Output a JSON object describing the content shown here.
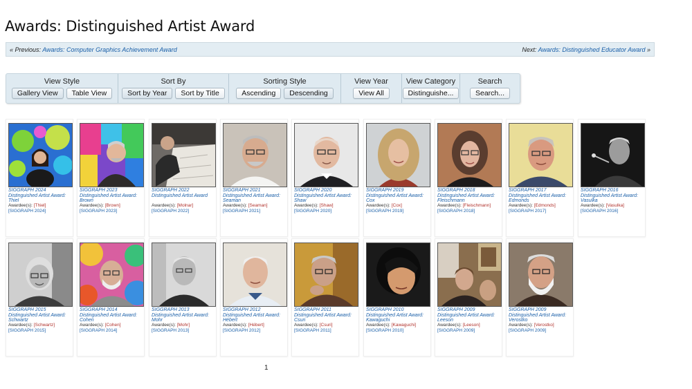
{
  "page": {
    "title": "Awards: Distinguished Artist Award"
  },
  "nav": {
    "prev_prefix": "« Previous: ",
    "prev_link": "Awards: Computer Graphics Achievement Award",
    "next_prefix": "Next: ",
    "next_link": "Awards: Distinguished Educator Award",
    "next_suffix": " »"
  },
  "controls": {
    "view_style": {
      "label": "View Style",
      "buttons": [
        "Gallery View",
        "Table View"
      ]
    },
    "sort_by": {
      "label": "Sort By",
      "buttons": [
        "Sort by Year",
        "Sort by Title"
      ]
    },
    "sorting_style": {
      "label": "Sorting Style",
      "buttons": [
        "Ascending",
        "Descending"
      ]
    },
    "view_year": {
      "label": "View Year",
      "buttons": [
        "View All"
      ]
    },
    "view_category": {
      "label": "View Category",
      "buttons": [
        "Distinguishe..."
      ]
    },
    "search": {
      "label": "Search",
      "buttons": [
        "Search..."
      ]
    }
  },
  "awardees_label": "Awardee(s):",
  "cards": [
    {
      "caption": "SIGGRAPH 2024 Distinguished Artist Award: Thiel",
      "awardee": "[Thiel]",
      "event": "[SIGGRAPH 2024]",
      "photo": "thiel-photo"
    },
    {
      "caption": "SIGGRAPH 2023 Distinguished Artist Award: Brown",
      "awardee": "[Brown]",
      "event": "[SIGGRAPH 2023]",
      "photo": "brown-photo"
    },
    {
      "caption": "SIGGRAPH 2022 Distinguished Artist Award",
      "awardee": "[Molnar]",
      "event": "[SIGGRAPH 2022]",
      "photo": "molnar-photo"
    },
    {
      "caption": "SIGGRAPH 2021 Distinguished Artist Award: Seaman",
      "awardee": "[Seaman]",
      "event": "[SIGGRAPH 2021]",
      "photo": "seaman-photo"
    },
    {
      "caption": "SIGGRAPH 2020 Distinguished Artist Award: Shaw",
      "awardee": "[Shaw]",
      "event": "[SIGGRAPH 2020]",
      "photo": "shaw-photo"
    },
    {
      "caption": "SIGGRAPH 2019 Distinguished Artist Award: Cox",
      "awardee": "[Cox]",
      "event": "[SIGGRAPH 2019]",
      "photo": "cox-photo"
    },
    {
      "caption": "SIGGRAPH 2018 Distinguished Artist Award: Fleischmann",
      "awardee": "[Fleischmann]",
      "event": "[SIGGRAPH 2018]",
      "photo": "fleischmann-photo"
    },
    {
      "caption": "SIGGRAPH 2017 Distinguished Artist Award: Edmonds",
      "awardee": "[Edmonds]",
      "event": "[SIGGRAPH 2017]",
      "photo": "edmonds-photo"
    },
    {
      "caption": "SIGGRAPH 2016 Distinguished Artist Award: Vasulka",
      "awardee": "[Vasulka]",
      "event": "[SIGGRAPH 2016]",
      "photo": "vasulka-photo"
    },
    {
      "caption": "SIGGRAPH 2015 Distinguished Artist Award: Schwartz",
      "awardee": "[Schwartz]",
      "event": "[SIGGRAPH 2015]",
      "photo": "schwartz-photo"
    },
    {
      "caption": "SIGGRAPH 2014 Distinguished Artist Award: Cohen",
      "awardee": "[Cohen]",
      "event": "[SIGGRAPH 2014]",
      "photo": "cohen-photo"
    },
    {
      "caption": "SIGGRAPH 2013 Distinguished Artist Award: Mohr",
      "awardee": "[Mohr]",
      "event": "[SIGGRAPH 2013]",
      "photo": "mohr-photo"
    },
    {
      "caption": "SIGGRAPH 2012 Distinguished Artist Award: Hébert",
      "awardee": "[Hébert]",
      "event": "[SIGGRAPH 2012]",
      "photo": "hebert-photo"
    },
    {
      "caption": "SIGGRAPH 2011 Distinguished Artist Award: Csuri",
      "awardee": "[Csuri]",
      "event": "[SIGGRAPH 2011]",
      "photo": "csuri-photo"
    },
    {
      "caption": "SIGGRAPH 2010 Distinguished Artist Award: Kawaguchi",
      "awardee": "[Kawaguchi]",
      "event": "[SIGGRAPH 2010]",
      "photo": "kawaguchi-photo"
    },
    {
      "caption": "SIGGRAPH 2009 Distinguished Artist Award: Leeson",
      "awardee": "[Leeson]",
      "event": "[SIGGRAPH 2009]",
      "photo": "leeson-photo"
    },
    {
      "caption": "SIGGRAPH 2009 Distinguished Artist Award: Verostko",
      "awardee": "[Verostko]",
      "event": "[SIGGRAPH 2009]",
      "photo": "verostko-photo"
    }
  ],
  "pager": {
    "current": "1"
  },
  "colors": {
    "link": "#1a5fa8",
    "awardee_link": "#b0302a",
    "nav_bg": "#e3edf3",
    "controls_bg": "#dfeaf1"
  }
}
